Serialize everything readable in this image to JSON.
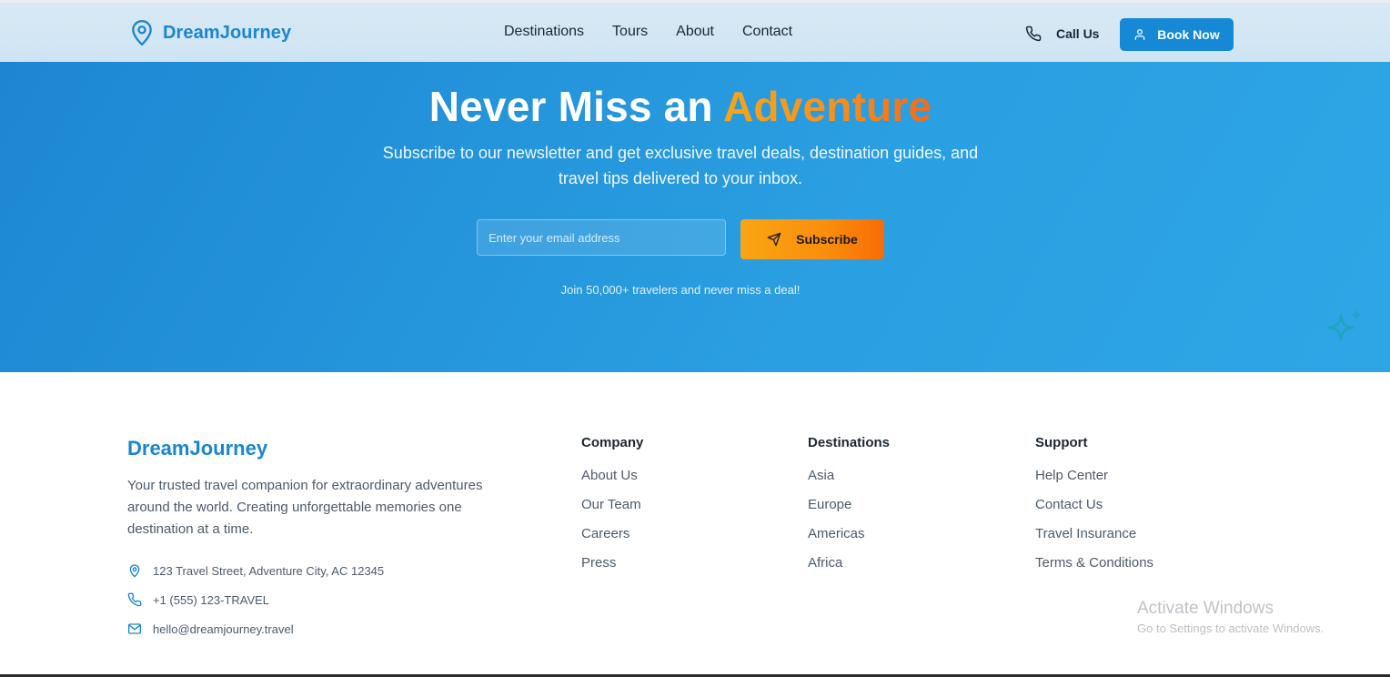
{
  "header": {
    "brand": "DreamJourney",
    "nav": [
      "Destinations",
      "Tours",
      "About",
      "Contact"
    ],
    "call_label": "Call Us",
    "book_label": "Book Now"
  },
  "hero": {
    "title_main": "Never Miss an",
    "title_accent": "Adventure",
    "subtitle": "Subscribe to our newsletter and get exclusive travel deals, destination guides, and travel tips delivered to your inbox.",
    "email_placeholder": "Enter your email address",
    "subscribe_label": "Subscribe",
    "note": "Join 50,000+ travelers and never miss a deal!"
  },
  "footer": {
    "brand": "DreamJourney",
    "description": "Your trusted travel companion for extraordinary adventures around the world. Creating unforgettable memories one destination at a time.",
    "address": "123 Travel Street, Adventure City, AC 12345",
    "phone": "+1 (555) 123-TRAVEL",
    "email": "hello@dreamjourney.travel",
    "columns": [
      {
        "title": "Company",
        "links": [
          "About Us",
          "Our Team",
          "Careers",
          "Press"
        ]
      },
      {
        "title": "Destinations",
        "links": [
          "Asia",
          "Europe",
          "Americas",
          "Africa"
        ]
      },
      {
        "title": "Support",
        "links": [
          "Help Center",
          "Contact Us",
          "Travel Insurance",
          "Terms & Conditions"
        ]
      }
    ]
  },
  "watermark": {
    "title": "Activate Windows",
    "subtitle": "Go to Settings to activate Windows."
  },
  "colors": {
    "brand": "#1a86cf",
    "accent_orange": "#f7931d",
    "hero_blue": "#2394dc"
  },
  "icons": {
    "logo": "map-pin-icon",
    "call": "phone-icon",
    "book": "user-icon",
    "subscribe": "send-icon",
    "sparkle": "sparkle-icon",
    "address": "map-pin-icon",
    "phone": "phone-icon",
    "email": "mail-icon"
  }
}
